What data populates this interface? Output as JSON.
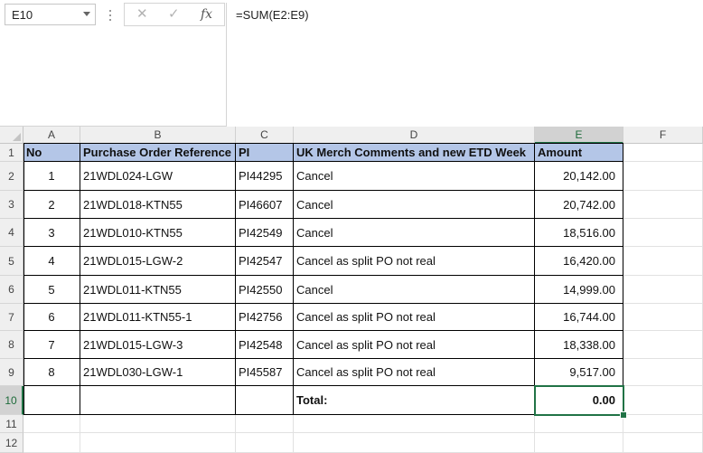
{
  "name_box": "E10",
  "formula_bar": {
    "formula": "=SUM(E2:E9)"
  },
  "columns": [
    "A",
    "B",
    "C",
    "D",
    "E",
    "F"
  ],
  "rows": [
    "1",
    "2",
    "3",
    "4",
    "5",
    "6",
    "7",
    "8",
    "9",
    "10",
    "11",
    "12"
  ],
  "headers": {
    "no": "No",
    "po": "Purchase Order Reference",
    "pi": "PI",
    "comments": "UK Merch Comments and new ETD Week",
    "amount": "Amount"
  },
  "data": [
    {
      "no": "1",
      "po": "21WDL024-LGW",
      "pi": "PI44295",
      "comments": "Cancel",
      "amount": "20,142.00"
    },
    {
      "no": "2",
      "po": "21WDL018-KTN55",
      "pi": "PI46607",
      "comments": "Cancel",
      "amount": "20,742.00"
    },
    {
      "no": "3",
      "po": "21WDL010-KTN55",
      "pi": "PI42549",
      "comments": "Cancel",
      "amount": "18,516.00"
    },
    {
      "no": "4",
      "po": "21WDL015-LGW-2",
      "pi": "PI42547",
      "comments": "Cancel as split PO not real",
      "amount": "16,420.00"
    },
    {
      "no": "5",
      "po": "21WDL011-KTN55",
      "pi": "PI42550",
      "comments": "Cancel",
      "amount": "14,999.00"
    },
    {
      "no": "6",
      "po": "21WDL011-KTN55-1",
      "pi": "PI42756",
      "comments": "Cancel as split PO not real",
      "amount": "16,744.00"
    },
    {
      "no": "7",
      "po": "21WDL015-LGW-3",
      "pi": "PI42548",
      "comments": "Cancel as split PO not real",
      "amount": "18,338.00"
    },
    {
      "no": "8",
      "po": "21WDL030-LGW-1",
      "pi": "PI45587",
      "comments": "Cancel as split PO not real",
      "amount": "9,517.00"
    }
  ],
  "total": {
    "label": "Total:",
    "value": "0.00"
  },
  "selected": {
    "column": "E",
    "row": "10"
  },
  "colors": {
    "header_fill": "#b4c6e7",
    "selection": "#217346"
  }
}
